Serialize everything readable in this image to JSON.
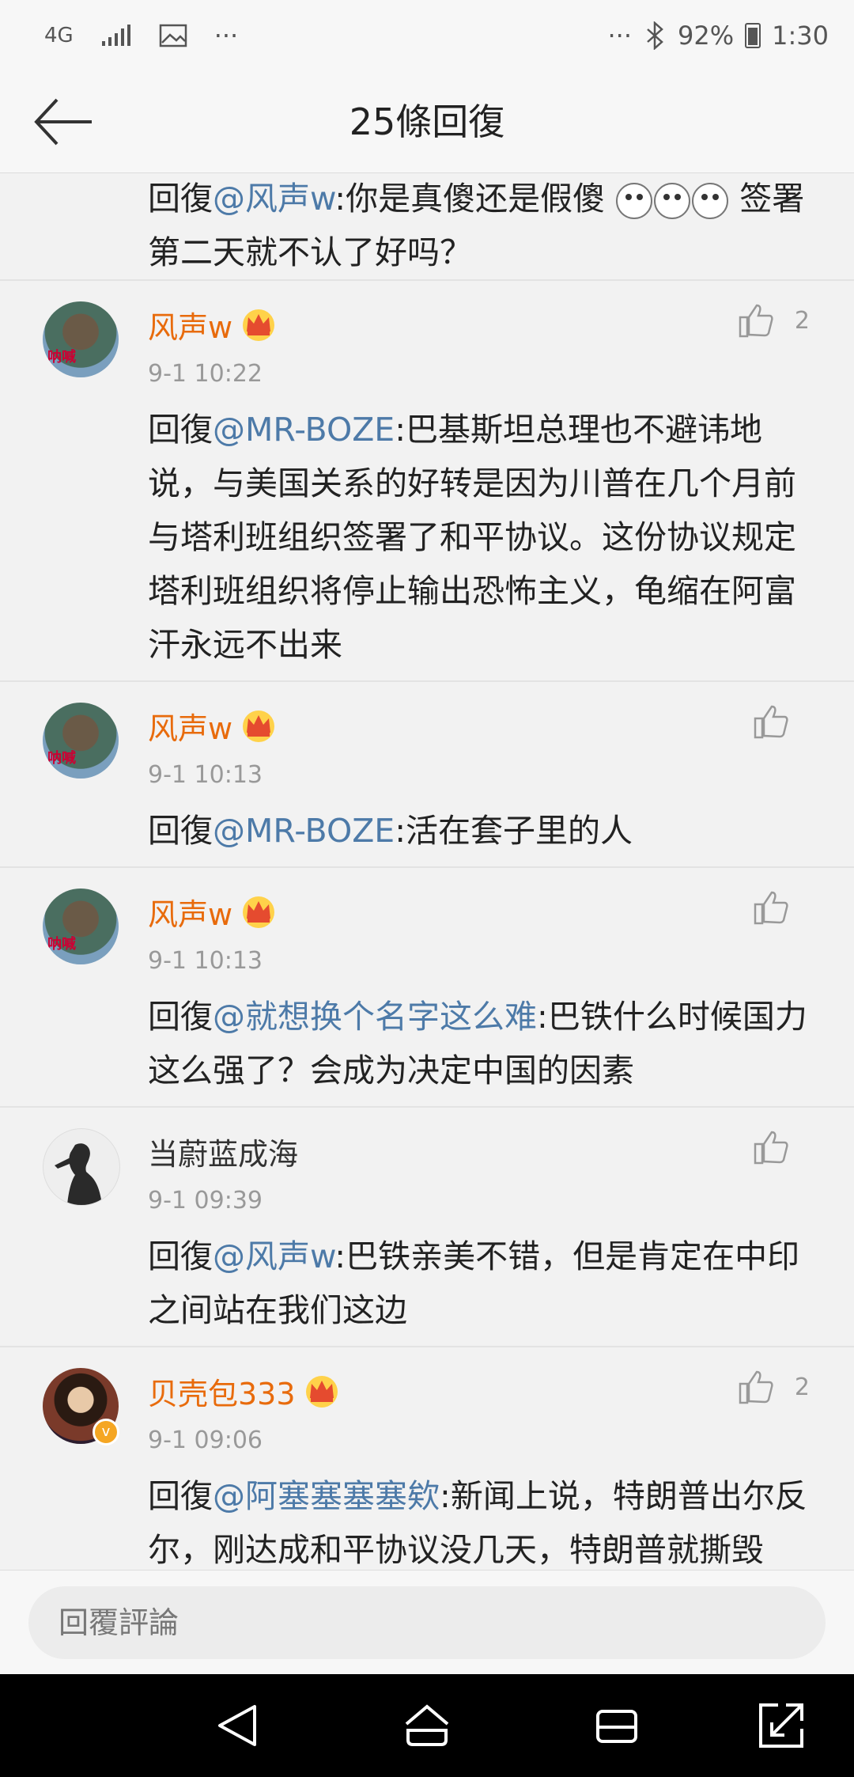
{
  "status_bar": {
    "network": "4G",
    "dots_left": "···",
    "dots_right": "···",
    "battery_percent": "92%",
    "time": "1:30"
  },
  "header": {
    "title": "25條回復"
  },
  "partial_comment": {
    "reply_prefix": "回復",
    "mention": "@风声w",
    "text_before_emoji": ":你是真傻还是假傻 ",
    "text_after_emoji": " 签署第二天就不认了好吗？"
  },
  "comments": [
    {
      "username": "风声w",
      "time": "9-1 10:22",
      "likes": "2",
      "reply_prefix": "回復",
      "mention": "@MR-BOZE",
      "text": ":巴基斯坦总理也不避讳地说，与美国关系的好转是因为川普在几个月前与塔利班组织签署了和平协议。这份协议规定塔利班组织将停止输出恐怖主义，龟缩在阿富汗永远不出来"
    },
    {
      "username": "风声w",
      "time": "9-1 10:13",
      "likes": "",
      "reply_prefix": "回復",
      "mention": "@MR-BOZE",
      "text": ":活在套子里的人"
    },
    {
      "username": "风声w",
      "time": "9-1 10:13",
      "likes": "",
      "reply_prefix": "回復",
      "mention": "@就想换个名字这么难",
      "text": ":巴铁什么时候国力这么强了？会成为决定中国的因素"
    },
    {
      "username": "当蔚蓝成海",
      "time": "9-1 09:39",
      "likes": "",
      "reply_prefix": "回復",
      "mention": "@风声w",
      "text": ":巴铁亲美不错，但是肯定在中印之间站在我们这边"
    },
    {
      "username": "贝壳包333",
      "time": "9-1 09:06",
      "likes": "2",
      "reply_prefix": "回復",
      "mention": "@阿塞塞塞塞欸",
      "text": ":新闻上说，特朗普出尔反尔，刚达成和平协议没几天，特朗普就撕毁"
    }
  ],
  "avatar_marks": {
    "green": "呐喊"
  },
  "reply_bar": {
    "placeholder": "回覆評論"
  },
  "colors": {
    "username_vip": "#e86b0c",
    "mention": "#4d7aa8",
    "timestamp": "#999999"
  }
}
